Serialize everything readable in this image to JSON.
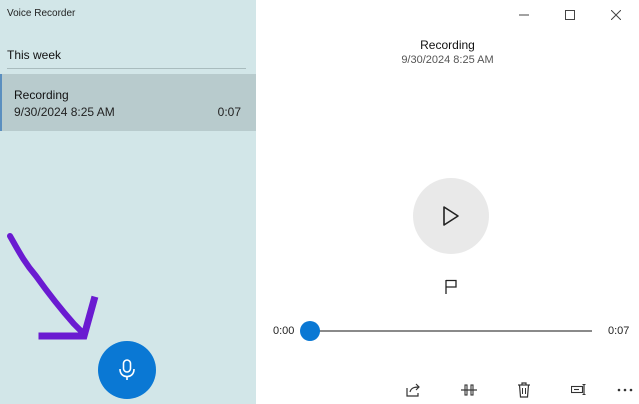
{
  "app": {
    "title": "Voice Recorder"
  },
  "list": {
    "section_header": "This week",
    "items": [
      {
        "name": "Recording",
        "date": "9/30/2024 8:25 AM",
        "duration": "0:07",
        "selected": true
      }
    ]
  },
  "player": {
    "title": "Recording",
    "date": "9/30/2024 8:25 AM",
    "time_current": "0:00",
    "time_total": "0:07",
    "progress": 0
  },
  "icons": {
    "play": "play-icon",
    "flag": "flag-icon",
    "mic": "microphone-icon",
    "share": "share-icon",
    "trim": "trim-icon",
    "delete": "delete-icon",
    "rename": "rename-icon",
    "more": "more-icon",
    "minimize": "minimize-icon",
    "maximize": "maximize-icon",
    "close": "close-icon"
  },
  "colors": {
    "accent": "#0a78d4",
    "sidebar_bg": "#d2e6e8",
    "selected_bg": "#b8cbcd",
    "annotation": "#6a1bd1"
  }
}
